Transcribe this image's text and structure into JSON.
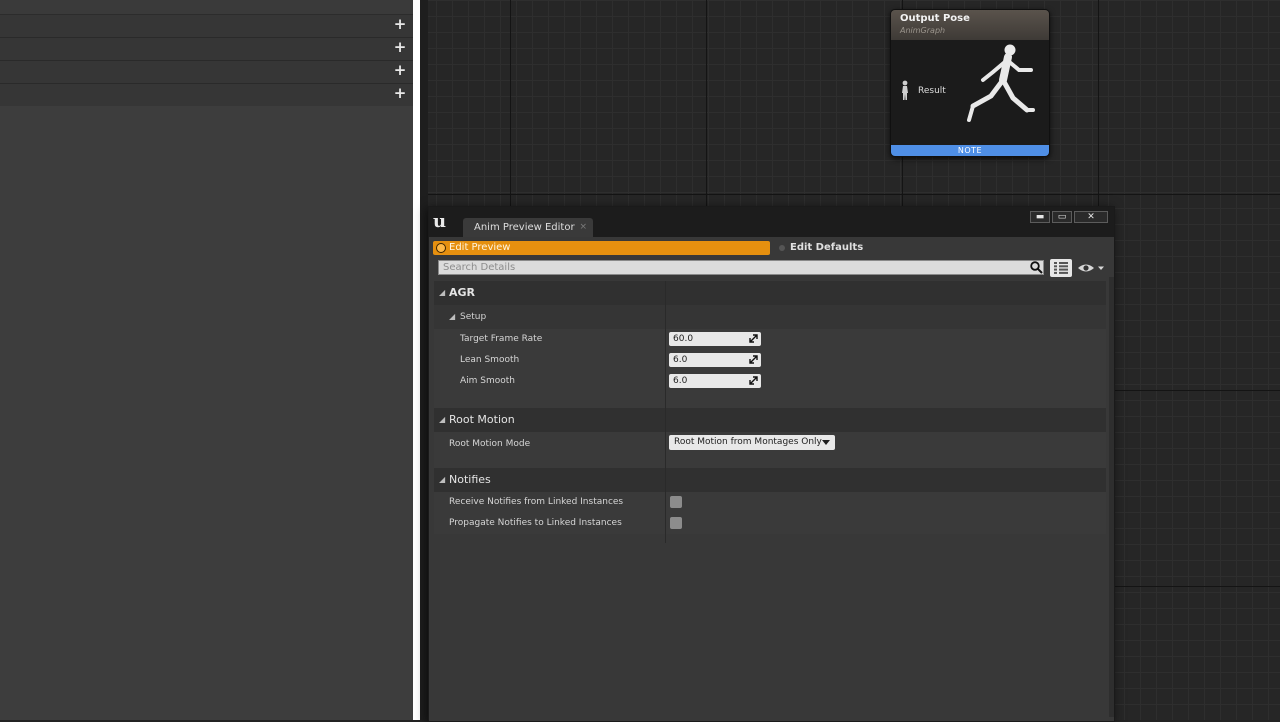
{
  "left_panel": {
    "rows": [
      {
        "action": "+"
      },
      {
        "action": "+"
      },
      {
        "action": "+"
      },
      {
        "action": "+"
      }
    ]
  },
  "graph_node": {
    "title": "Output Pose",
    "subtitle": "AnimGraph",
    "pin_label": "Result",
    "note_label": "NOTE"
  },
  "editor_window": {
    "tab_label": "Anim Preview Editor",
    "tab_close": "×",
    "buttons": {
      "minimize": "▬",
      "maximize": "▭",
      "close": "✕"
    },
    "modes": {
      "edit_preview": "Edit Preview",
      "edit_defaults": "Edit Defaults",
      "active": "edit_preview"
    },
    "search": {
      "placeholder": "Search Details",
      "value": ""
    },
    "categories": {
      "agr": {
        "label": "AGR",
        "setup": {
          "label": "Setup",
          "properties": [
            {
              "label": "Target Frame Rate",
              "value": "60.0"
            },
            {
              "label": "Lean Smooth",
              "value": "6.0"
            },
            {
              "label": "Aim Smooth",
              "value": "6.0"
            }
          ]
        }
      },
      "root_motion": {
        "label": "Root Motion",
        "mode_label": "Root Motion Mode",
        "mode_value": "Root Motion from Montages Only"
      },
      "notifies": {
        "label": "Notifies",
        "receive_label": "Receive Notifies from Linked Instances",
        "receive_checked": false,
        "propagate_label": "Propagate Notifies to Linked Instances",
        "propagate_checked": false
      }
    }
  },
  "colors": {
    "accent_orange": "#e6900f",
    "note_blue": "#4f8fe6",
    "panel_bg": "#383838",
    "graph_bg": "#262626"
  },
  "icons": [
    "plus-icon",
    "unreal-logo-icon",
    "search-icon",
    "grid-view-icon",
    "eye-icon",
    "chevron-down-icon",
    "mannequin-icon",
    "pose-pin-icon",
    "resize-icon"
  ]
}
